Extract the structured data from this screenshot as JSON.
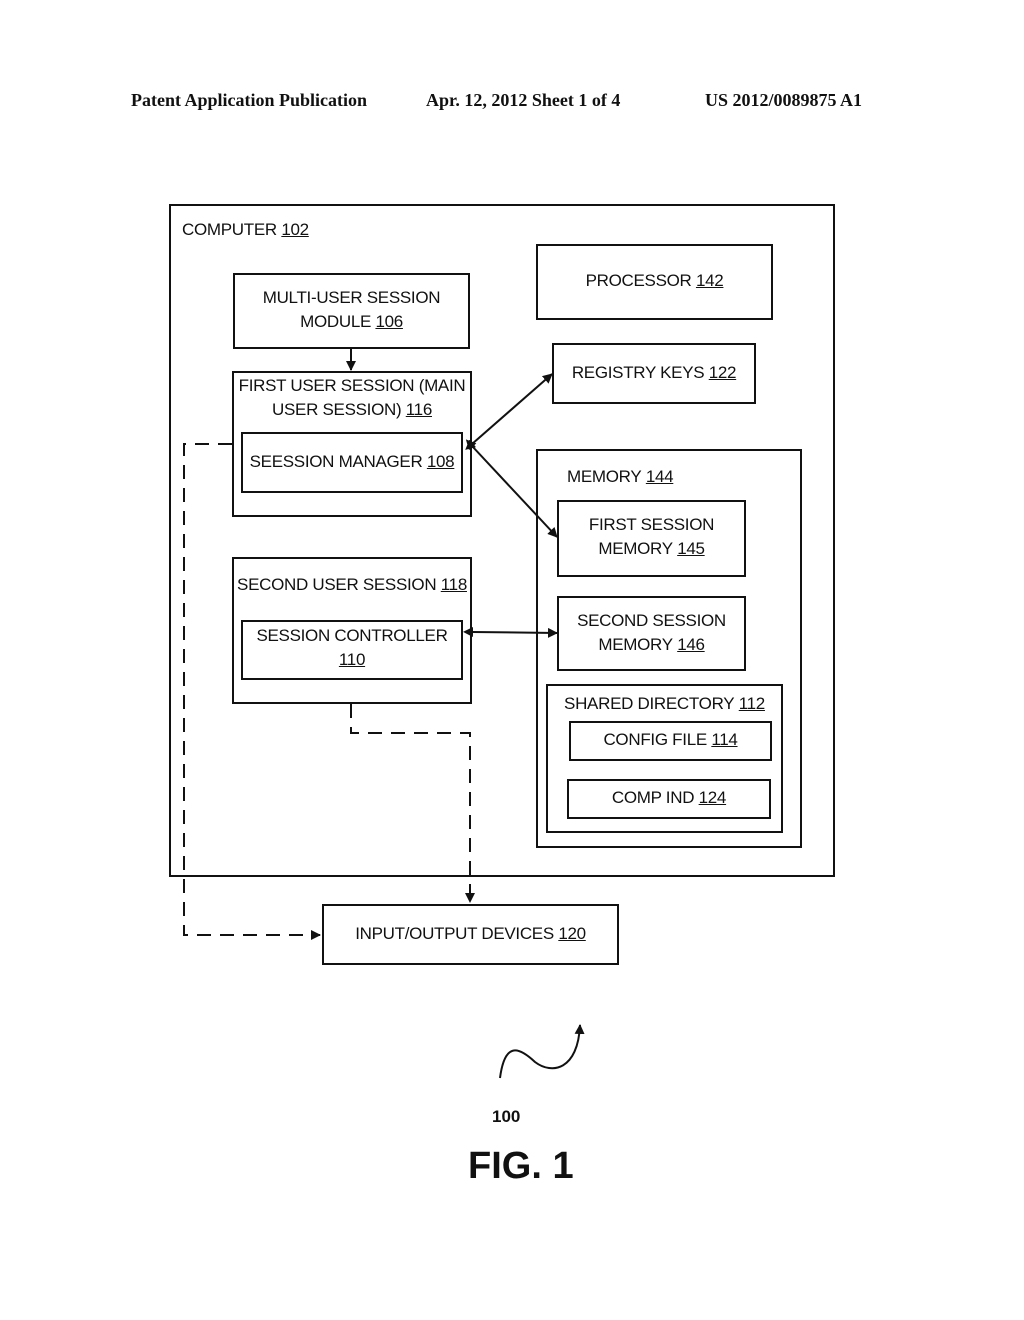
{
  "header": {
    "left": "Patent Application Publication",
    "center": "Apr. 12, 2012  Sheet 1 of 4",
    "right": "US 2012/0089875 A1"
  },
  "diagram": {
    "computer": {
      "text": "COMPUTER",
      "num": "102"
    },
    "multi_user_module": {
      "line1": "MULTI-USER SESSION",
      "line2": "MODULE",
      "num": "106"
    },
    "first_user_session": {
      "line1": "FIRST USER SESSION (MAIN",
      "line2": "USER SESSION)",
      "num": "116"
    },
    "session_manager": {
      "text": "SEESSION MANAGER",
      "num": "108"
    },
    "second_user_session": {
      "text": "SECOND USER SESSION",
      "num": "118"
    },
    "session_controller": {
      "line1": "SESSION CONTROLLER",
      "num": "110"
    },
    "processor": {
      "text": "PROCESSOR",
      "num": "142"
    },
    "registry_keys": {
      "text": "REGISTRY KEYS",
      "num": "122"
    },
    "memory": {
      "text": "MEMORY",
      "num": "144"
    },
    "first_session_memory": {
      "line1": "FIRST SESSION",
      "line2": "MEMORY",
      "num": "145"
    },
    "second_session_memory": {
      "line1": "SECOND SESSION",
      "line2": "MEMORY",
      "num": "146"
    },
    "shared_directory": {
      "text": "SHARED DIRECTORY",
      "num": "112"
    },
    "config_file": {
      "text": "CONFIG FILE",
      "num": "114"
    },
    "comp_ind": {
      "text": "COMP IND",
      "num": "124"
    },
    "io_devices": {
      "text": "INPUT/OUTPUT DEVICES",
      "num": "120"
    }
  },
  "reference_numeral": "100",
  "figure_label": "FIG. 1"
}
